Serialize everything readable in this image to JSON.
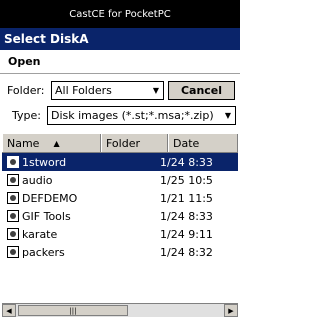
{
  "window": {
    "title": "CastCE for PocketPC"
  },
  "dialog": {
    "title": "Select DiskA"
  },
  "menu": {
    "open_label": "Open"
  },
  "folder": {
    "label": "Folder:",
    "value": "All Folders"
  },
  "type": {
    "label": "Type:",
    "value": "Disk images (*.st;*.msa;*.zip)"
  },
  "buttons": {
    "cancel_label": "Cancel"
  },
  "columns": {
    "name": "Name",
    "folder": "Folder",
    "date": "Date"
  },
  "files": [
    {
      "name": "1stword",
      "date": "1/24 8:33..."
    },
    {
      "name": "audio",
      "date": "1/25 10:5..."
    },
    {
      "name": "DEFDEMO",
      "date": "1/21 11:53..."
    },
    {
      "name": "GIF Tools",
      "date": "1/24 8:33..."
    },
    {
      "name": "karate",
      "date": "1/24 9:11..."
    },
    {
      "name": "packers",
      "date": "1/24 8:32..."
    }
  ],
  "selected_index": 0,
  "colors": {
    "selection": "#0a246a",
    "titlebar": "#000000"
  }
}
